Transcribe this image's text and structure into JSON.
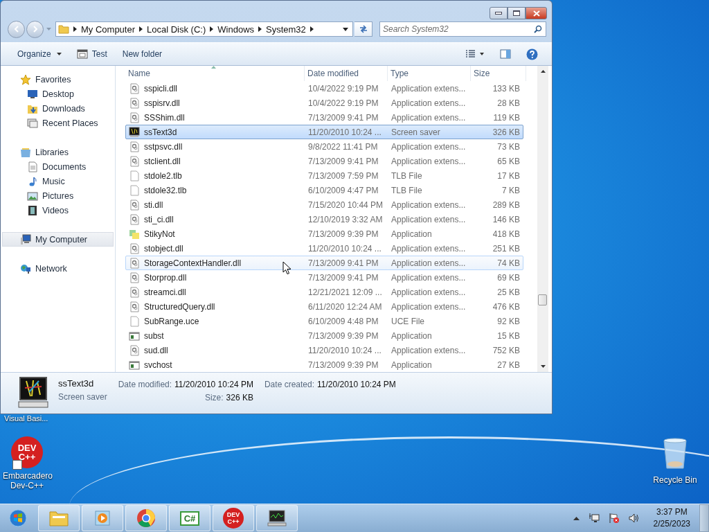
{
  "desktop": {
    "icons": [
      {
        "kind": "vb",
        "label": "Visual Basi..."
      },
      {
        "kind": "devcpp",
        "label": "Embarcadero Dev-C++",
        "logo": [
          "DEV",
          "C++"
        ]
      },
      {
        "kind": "recycle",
        "label": "Recycle Bin"
      }
    ]
  },
  "window": {
    "address": [
      "My Computer",
      "Local Disk (C:)",
      "Windows",
      "System32"
    ],
    "search": {
      "placeholder": "Search System32"
    },
    "toolbar": [
      {
        "kind": "menu",
        "label": "Organize"
      },
      {
        "kind": "app",
        "label": "Test"
      },
      {
        "kind": "plain",
        "label": "New folder"
      }
    ],
    "nav": [
      {
        "kind": "group",
        "label": "Favorites",
        "selected": false
      },
      {
        "kind": "item",
        "label": "Desktop",
        "selected": false
      },
      {
        "kind": "item",
        "label": "Downloads",
        "selected": false
      },
      {
        "kind": "item",
        "label": "Recent Places",
        "selected": false
      },
      {
        "kind": "gap"
      },
      {
        "kind": "group",
        "label": "Libraries",
        "selected": false
      },
      {
        "kind": "item",
        "label": "Documents",
        "selected": false
      },
      {
        "kind": "item",
        "label": "Music",
        "selected": false
      },
      {
        "kind": "item",
        "label": "Pictures",
        "selected": false
      },
      {
        "kind": "item",
        "label": "Videos",
        "selected": false
      },
      {
        "kind": "gap"
      },
      {
        "kind": "group",
        "label": "My Computer",
        "selected": true
      },
      {
        "kind": "gap"
      },
      {
        "kind": "group",
        "label": "Network",
        "selected": false
      }
    ],
    "columns": [
      "Name",
      "Date modified",
      "Type",
      "Size"
    ],
    "rows": [
      {
        "kind": "dll",
        "name": "sspicli.dll",
        "date": "10/4/2022 9:19 PM",
        "type": "Application extens...",
        "size": "133 KB",
        "selected": false,
        "hovered": false
      },
      {
        "kind": "dll",
        "name": "sspisrv.dll",
        "date": "10/4/2022 9:19 PM",
        "type": "Application extens...",
        "size": "28 KB",
        "selected": false,
        "hovered": false
      },
      {
        "kind": "dll",
        "name": "SSShim.dll",
        "date": "7/13/2009 9:41 PM",
        "type": "Application extens...",
        "size": "119 KB",
        "selected": false,
        "hovered": false
      },
      {
        "kind": "screensaver",
        "name": "ssText3d",
        "date": "11/20/2010 10:24 ...",
        "type": "Screen saver",
        "size": "326 KB",
        "selected": true,
        "hovered": false
      },
      {
        "kind": "dll",
        "name": "sstpsvc.dll",
        "date": "9/8/2022 11:41 PM",
        "type": "Application extens...",
        "size": "73 KB",
        "selected": false,
        "hovered": false
      },
      {
        "kind": "dll",
        "name": "stclient.dll",
        "date": "7/13/2009 9:41 PM",
        "type": "Application extens...",
        "size": "65 KB",
        "selected": false,
        "hovered": false
      },
      {
        "kind": "blank",
        "name": "stdole2.tlb",
        "date": "7/13/2009 7:59 PM",
        "type": "TLB File",
        "size": "17 KB",
        "selected": false,
        "hovered": false
      },
      {
        "kind": "blank",
        "name": "stdole32.tlb",
        "date": "6/10/2009 4:47 PM",
        "type": "TLB File",
        "size": "7 KB",
        "selected": false,
        "hovered": false
      },
      {
        "kind": "dll",
        "name": "sti.dll",
        "date": "7/15/2020 10:44 PM",
        "type": "Application extens...",
        "size": "289 KB",
        "selected": false,
        "hovered": false
      },
      {
        "kind": "dll",
        "name": "sti_ci.dll",
        "date": "12/10/2019 3:32 AM",
        "type": "Application extens...",
        "size": "146 KB",
        "selected": false,
        "hovered": false
      },
      {
        "kind": "sticky",
        "name": "StikyNot",
        "date": "7/13/2009 9:39 PM",
        "type": "Application",
        "size": "418 KB",
        "selected": false,
        "hovered": false
      },
      {
        "kind": "dll",
        "name": "stobject.dll",
        "date": "11/20/2010 10:24 ...",
        "type": "Application extens...",
        "size": "251 KB",
        "selected": false,
        "hovered": false
      },
      {
        "kind": "dll",
        "name": "StorageContextHandler.dll",
        "date": "7/13/2009 9:41 PM",
        "type": "Application extens...",
        "size": "74 KB",
        "selected": false,
        "hovered": true
      },
      {
        "kind": "dll",
        "name": "Storprop.dll",
        "date": "7/13/2009 9:41 PM",
        "type": "Application extens...",
        "size": "69 KB",
        "selected": false,
        "hovered": false
      },
      {
        "kind": "dll",
        "name": "streamci.dll",
        "date": "12/21/2021 12:09 ...",
        "type": "Application extens...",
        "size": "25 KB",
        "selected": false,
        "hovered": false
      },
      {
        "kind": "dll",
        "name": "StructuredQuery.dll",
        "date": "6/11/2020 12:24 AM",
        "type": "Application extens...",
        "size": "476 KB",
        "selected": false,
        "hovered": false
      },
      {
        "kind": "blank",
        "name": "SubRange.uce",
        "date": "6/10/2009 4:48 PM",
        "type": "UCE File",
        "size": "92 KB",
        "selected": false,
        "hovered": false
      },
      {
        "kind": "app",
        "name": "subst",
        "date": "7/13/2009 9:39 PM",
        "type": "Application",
        "size": "15 KB",
        "selected": false,
        "hovered": false
      },
      {
        "kind": "dll",
        "name": "sud.dll",
        "date": "11/20/2010 10:24 ...",
        "type": "Application extens...",
        "size": "752 KB",
        "selected": false,
        "hovered": false
      },
      {
        "kind": "app",
        "name": "svchost",
        "date": "7/13/2009 9:39 PM",
        "type": "Application",
        "size": "27 KB",
        "selected": false,
        "hovered": false
      }
    ],
    "details": {
      "name": "ssText3d",
      "type": "Screen saver",
      "fields": [
        {
          "label": "Date modified:",
          "value": "11/20/2010 10:24 PM"
        },
        {
          "label": "Date created:",
          "value": "11/20/2010 10:24 PM"
        },
        {
          "label": "Size:",
          "value": "326 KB"
        }
      ]
    }
  },
  "taskbar": {
    "items": [
      {
        "kind": "explorer"
      },
      {
        "kind": "media"
      },
      {
        "kind": "chrome"
      },
      {
        "kind": "csharp",
        "text": "C#"
      },
      {
        "kind": "devcpp",
        "text": [
          "DEV",
          "C++"
        ]
      },
      {
        "kind": "monitor"
      }
    ],
    "clock": {
      "time": "3:37 PM",
      "date": "2/25/2023"
    }
  }
}
